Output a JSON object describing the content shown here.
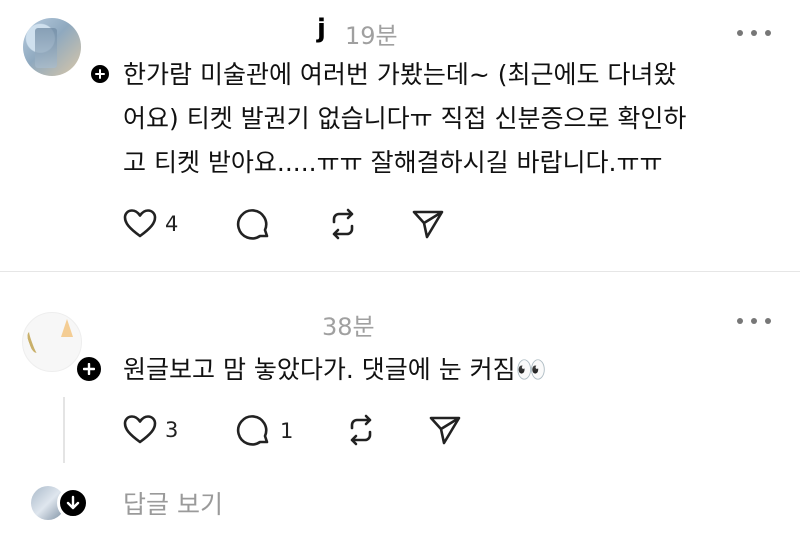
{
  "post1": {
    "username": "j",
    "time": "19분",
    "lines": [
      "한가람 미술관에 여러번 가봤는데~ (최근에도 다녀왔",
      "어요) 티켓 발권기 없습니다ㅠ 직접 신분증으로 확인하",
      "고 티켓 받아요.....ㅠㅠ 잘해결하시길 바랍니다.ㅠㅠ"
    ],
    "likes": "4",
    "icons": {
      "like": "heart-icon",
      "reply": "comment-icon",
      "repost": "repost-icon",
      "share": "send-icon",
      "more": "more-icon"
    }
  },
  "post2": {
    "time": "38분",
    "text": "원글보고 맘 놓았다가. 댓글에 눈 커짐👀",
    "likes": "3",
    "replies": "1"
  },
  "footer": {
    "view_replies": "답글 보기"
  }
}
